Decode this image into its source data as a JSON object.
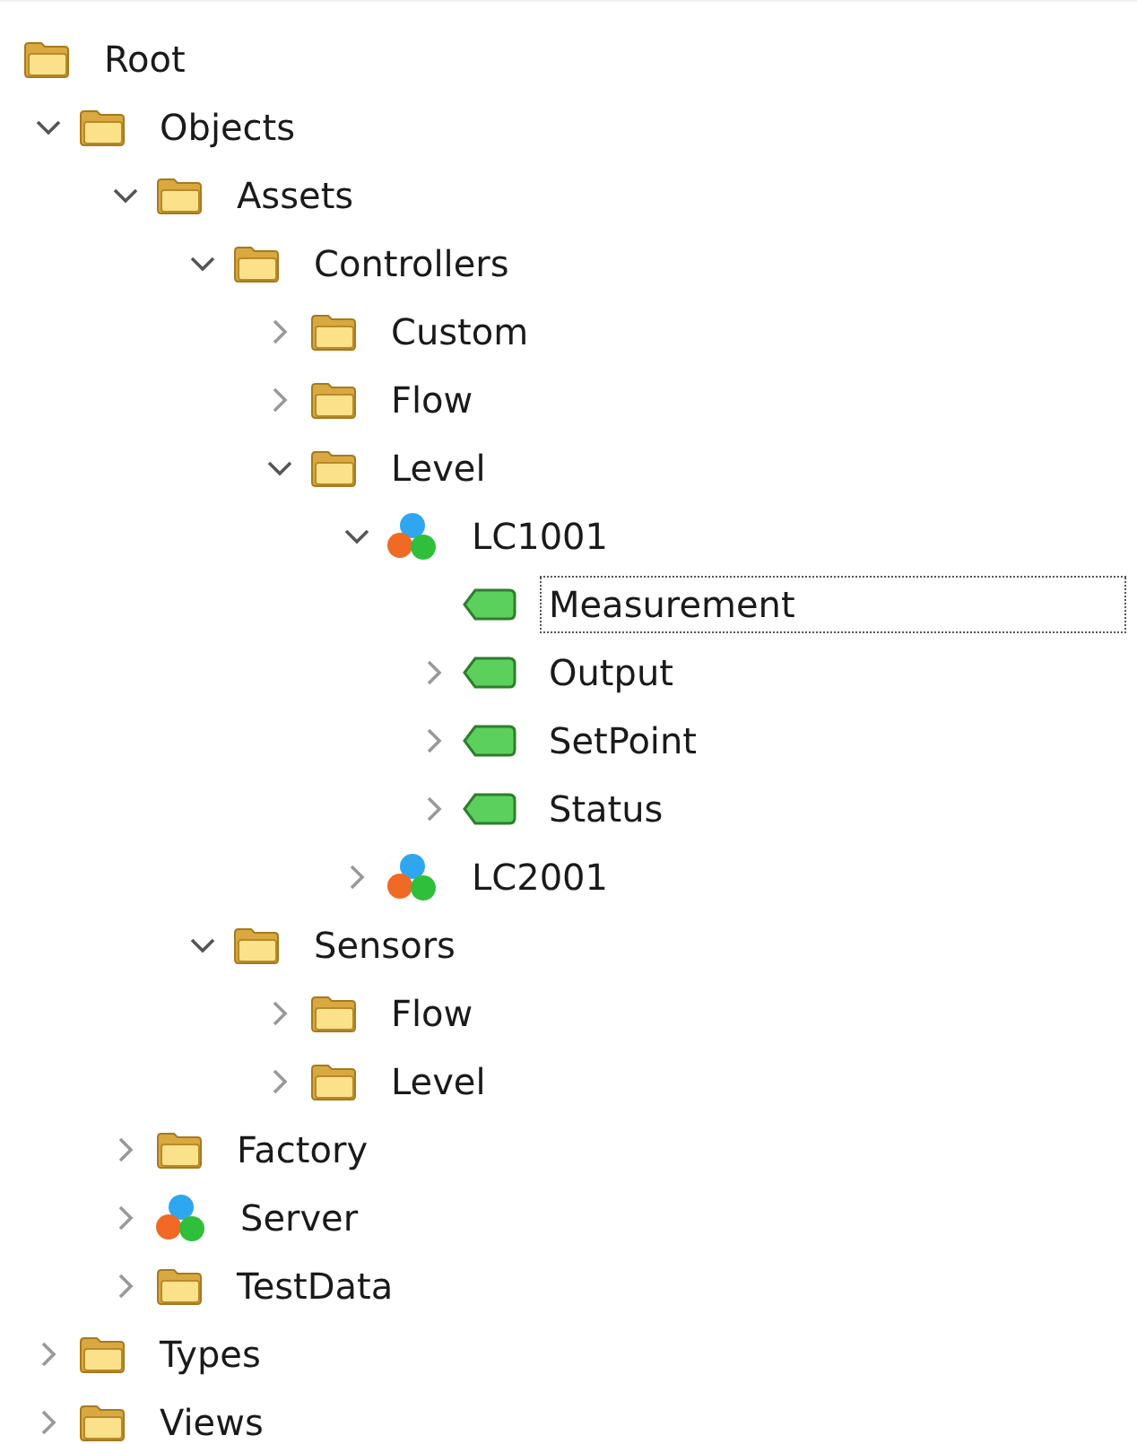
{
  "tree": [
    {
      "label": "Root",
      "kind": "folder",
      "selected": false,
      "children": [
        {
          "label": "Objects",
          "kind": "folder",
          "expanded": true,
          "selected": false,
          "children": [
            {
              "label": "Assets",
              "kind": "folder",
              "expanded": true,
              "selected": false,
              "children": [
                {
                  "label": "Controllers",
                  "kind": "folder",
                  "expanded": true,
                  "selected": false,
                  "children": [
                    {
                      "label": "Custom",
                      "kind": "folder",
                      "expanded": false,
                      "selected": false
                    },
                    {
                      "label": "Flow",
                      "kind": "folder",
                      "expanded": false,
                      "selected": false
                    },
                    {
                      "label": "Level",
                      "kind": "folder",
                      "expanded": true,
                      "selected": false,
                      "children": [
                        {
                          "label": "LC1001",
                          "kind": "object",
                          "expanded": true,
                          "selected": false,
                          "children": [
                            {
                              "label": "Measurement",
                              "kind": "variable",
                              "selected": true
                            },
                            {
                              "label": "Output",
                              "kind": "variable",
                              "expanded": false,
                              "selected": false
                            },
                            {
                              "label": "SetPoint",
                              "kind": "variable",
                              "expanded": false,
                              "selected": false
                            },
                            {
                              "label": "Status",
                              "kind": "variable",
                              "expanded": false,
                              "selected": false
                            }
                          ]
                        },
                        {
                          "label": "LC2001",
                          "kind": "object",
                          "expanded": false,
                          "selected": false
                        }
                      ]
                    }
                  ]
                },
                {
                  "label": "Sensors",
                  "kind": "folder",
                  "expanded": true,
                  "selected": false,
                  "children": [
                    {
                      "label": "Flow",
                      "kind": "folder",
                      "expanded": false,
                      "selected": false
                    },
                    {
                      "label": "Level",
                      "kind": "folder",
                      "expanded": false,
                      "selected": false
                    }
                  ]
                }
              ]
            },
            {
              "label": "Factory",
              "kind": "folder",
              "expanded": false,
              "selected": false
            },
            {
              "label": "Server",
              "kind": "object",
              "expanded": false,
              "selected": false
            },
            {
              "label": "TestData",
              "kind": "folder",
              "expanded": false,
              "selected": false
            }
          ]
        },
        {
          "label": "Types",
          "kind": "folder",
          "expanded": false,
          "selected": false
        },
        {
          "label": "Views",
          "kind": "folder",
          "expanded": false,
          "selected": false
        }
      ]
    }
  ]
}
